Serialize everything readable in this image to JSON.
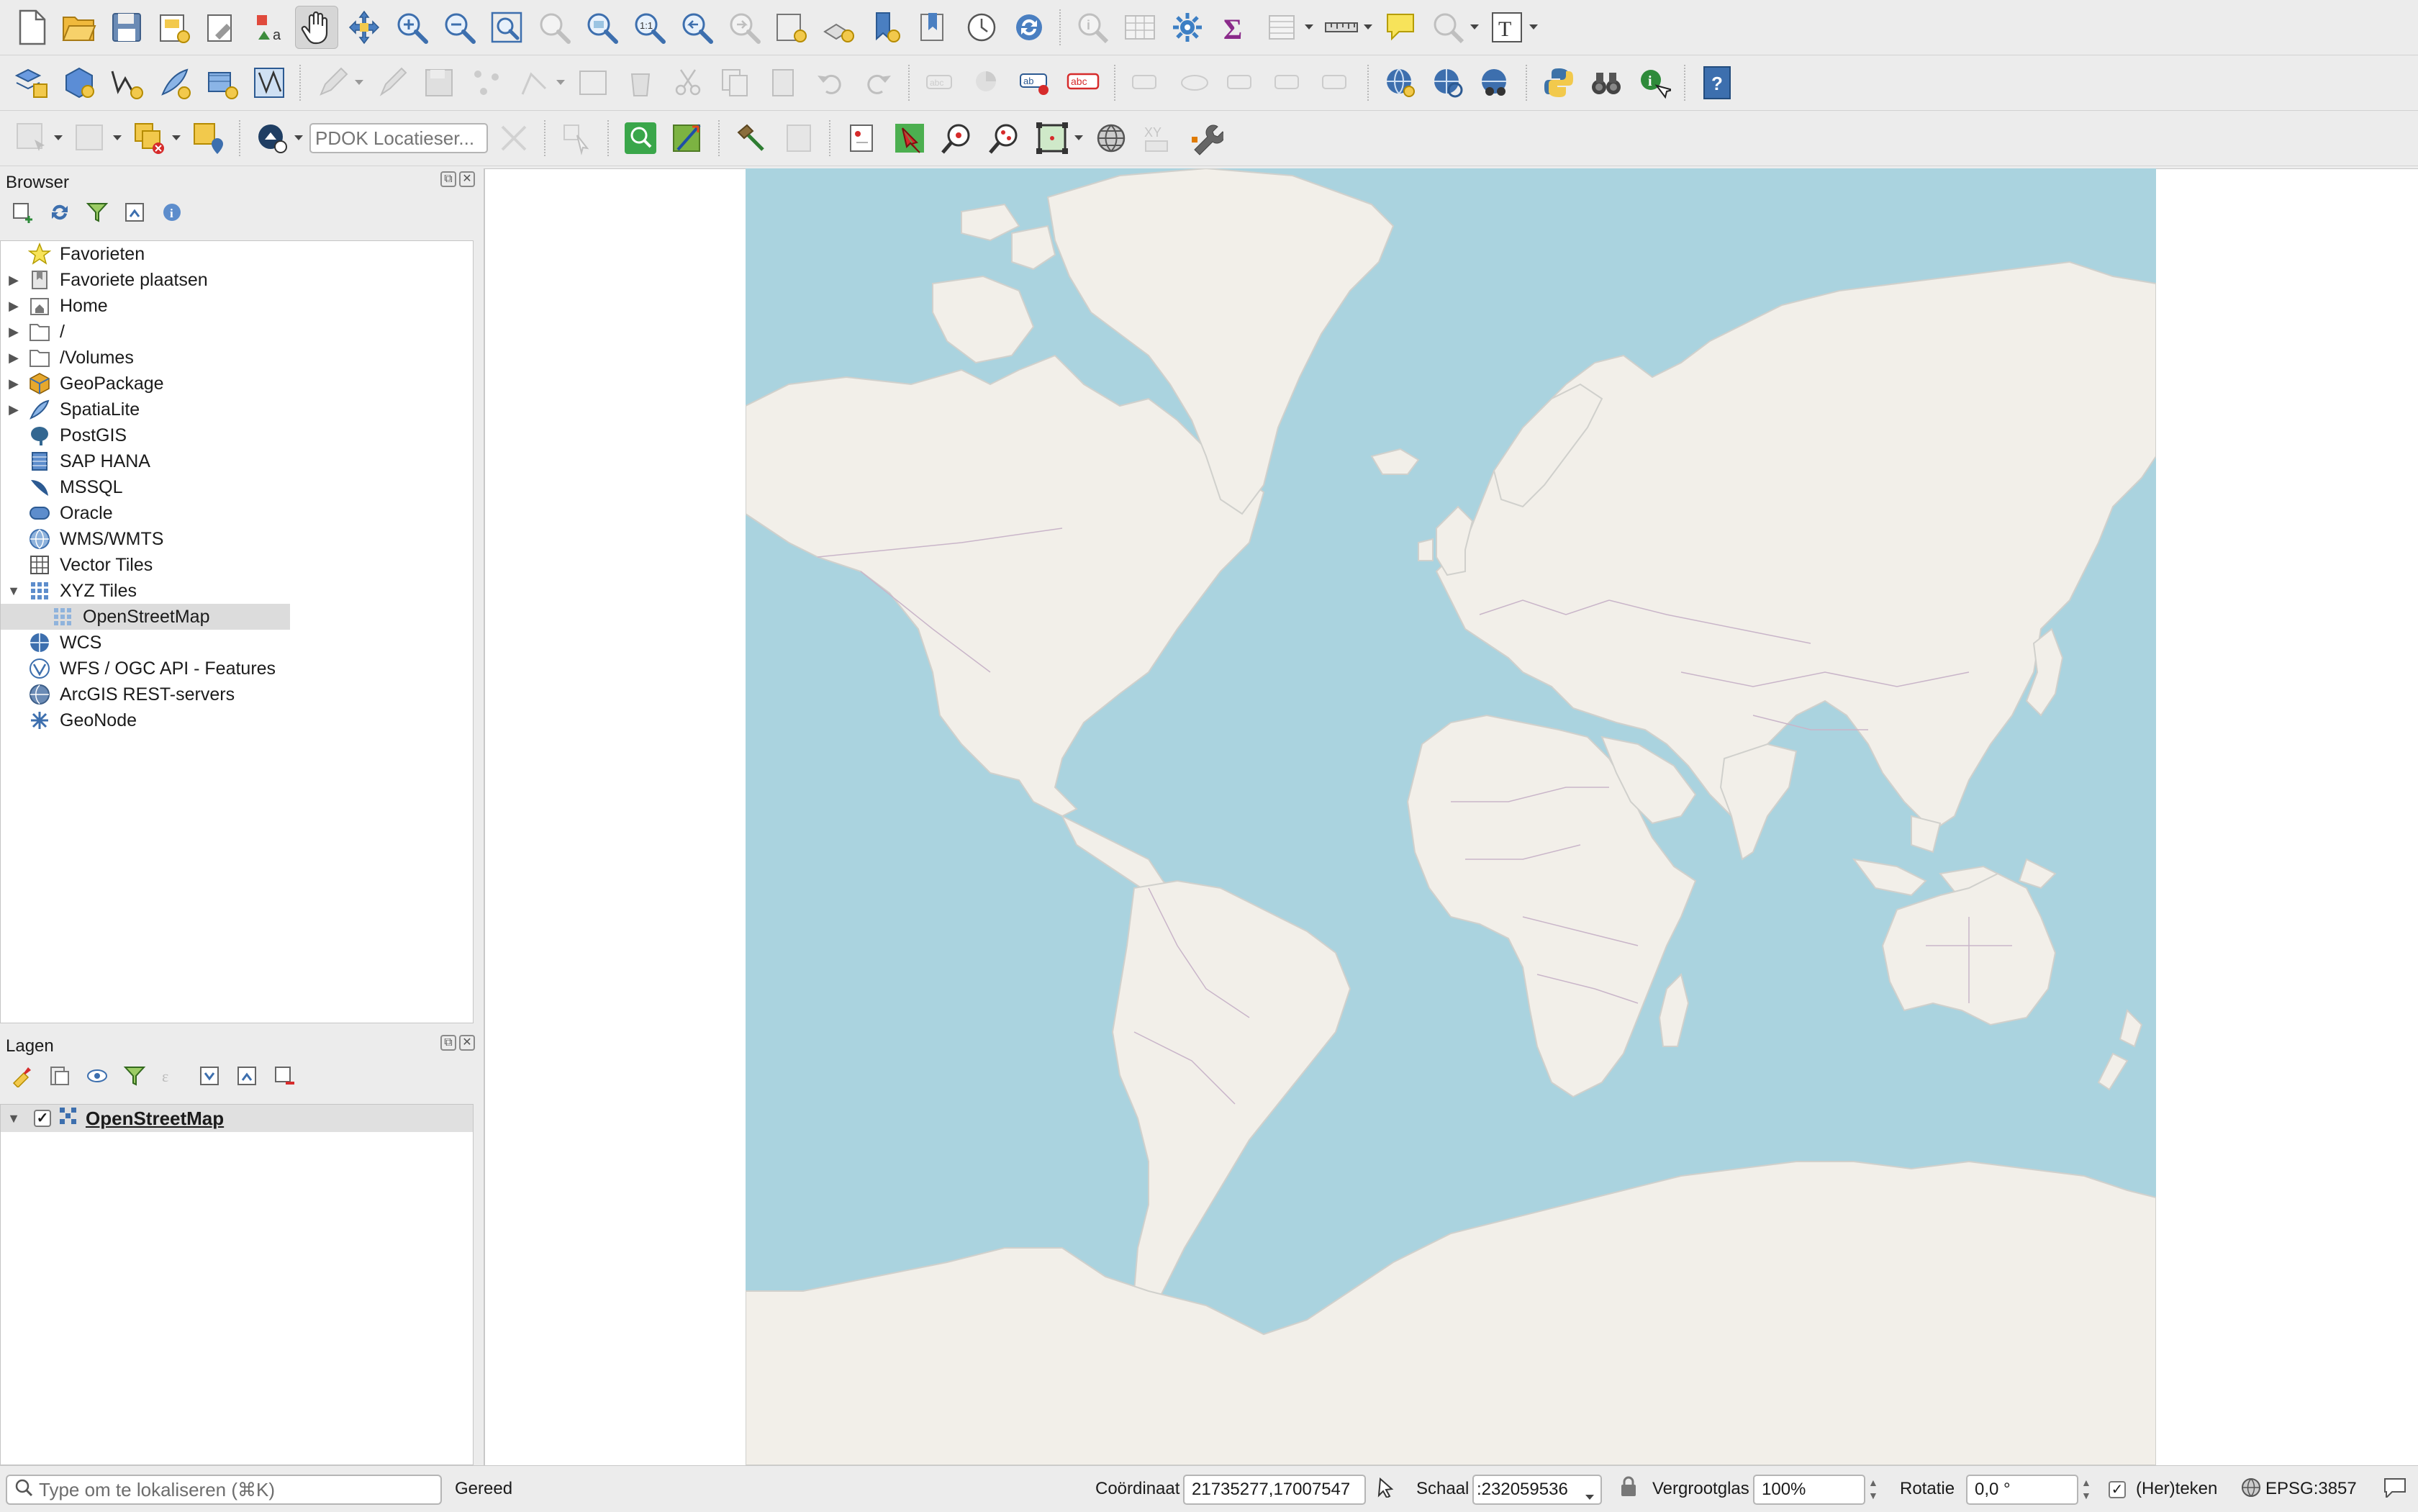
{
  "toolbar": {
    "row1": [
      "new-project",
      "open-project",
      "save-project",
      "new-print-layout",
      "show-layout-manager",
      "style-manager",
      "pan-map",
      "pan-to-selection",
      "zoom-in",
      "zoom-out",
      "zoom-full",
      "zoom-to-selection",
      "zoom-to-layer",
      "zoom-to-native-resolution",
      "zoom-last",
      "zoom-next",
      "new-map-view",
      "new-3d-map-view",
      "new-spatial-bookmark",
      "show-spatial-bookmarks",
      "temporal-controller",
      "refresh",
      "identify-features",
      "open-attribute-table",
      "open-field-calculator",
      "toggle-processing-toolbox",
      "show-statistical-summary",
      "measure-line",
      "map-tips",
      "select-feature",
      "text-annotation"
    ],
    "search_placeholder": "PDOK Locatieser..."
  },
  "browser": {
    "title": "Browser",
    "items": [
      {
        "label": "Favorieten",
        "icon": "star-icon",
        "expandable": false
      },
      {
        "label": "Favoriete plaatsen",
        "icon": "bookmark-icon",
        "expandable": true
      },
      {
        "label": "Home",
        "icon": "home-folder-icon",
        "expandable": true
      },
      {
        "label": "/",
        "icon": "folder-icon",
        "expandable": true
      },
      {
        "label": "/Volumes",
        "icon": "folder-icon",
        "expandable": true
      },
      {
        "label": "GeoPackage",
        "icon": "geopackage-icon",
        "expandable": true
      },
      {
        "label": "SpatiaLite",
        "icon": "spatialite-icon",
        "expandable": true
      },
      {
        "label": "PostGIS",
        "icon": "postgis-icon",
        "expandable": false
      },
      {
        "label": "SAP HANA",
        "icon": "sap-hana-icon",
        "expandable": false
      },
      {
        "label": "MSSQL",
        "icon": "mssql-icon",
        "expandable": false
      },
      {
        "label": "Oracle",
        "icon": "oracle-icon",
        "expandable": false
      },
      {
        "label": "WMS/WMTS",
        "icon": "wms-icon",
        "expandable": false
      },
      {
        "label": "Vector Tiles",
        "icon": "vector-tiles-icon",
        "expandable": false
      },
      {
        "label": "XYZ Tiles",
        "icon": "xyz-tiles-icon",
        "expandable": true
      },
      {
        "label": "OpenStreetMap",
        "icon": "xyz-layer-icon",
        "expandable": false
      },
      {
        "label": "WCS",
        "icon": "wcs-icon",
        "expandable": false
      },
      {
        "label": "WFS / OGC API - Features",
        "icon": "wfs-icon",
        "expandable": false
      },
      {
        "label": "ArcGIS REST-servers",
        "icon": "arcgis-icon",
        "expandable": false
      },
      {
        "label": "GeoNode",
        "icon": "geonode-icon",
        "expandable": false
      }
    ]
  },
  "layers": {
    "title": "Lagen",
    "items": [
      {
        "label": "OpenStreetMap",
        "checked": true
      }
    ]
  },
  "map": {
    "ocean_color": "#aad3df",
    "land_color": "#f2efe9",
    "border_color": "#c9b5c9"
  },
  "status": {
    "search_placeholder": "Type om te lokaliseren (⌘K)",
    "message": "Gereed",
    "coord_label": "Coördinaat",
    "coord_value": "21735277,17007547",
    "scale_label": "Schaal",
    "scale_value": ":232059536",
    "magnifier_label": "Vergrootglas",
    "magnifier_value": "100%",
    "rotation_label": "Rotatie",
    "rotation_value": "0,0 °",
    "render_label": "(Her)teken",
    "crs_label": "EPSG:3857"
  }
}
